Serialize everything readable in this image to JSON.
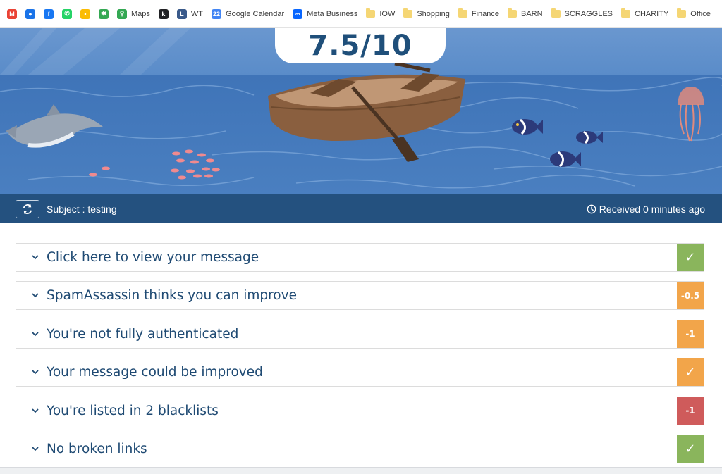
{
  "bookmarks": [
    {
      "label": "",
      "icon": "gmail-icon",
      "color": "#ea4335",
      "glyph": "M"
    },
    {
      "label": "",
      "icon": "contacts-icon",
      "color": "#1a73e8",
      "glyph": "●"
    },
    {
      "label": "",
      "icon": "facebook-icon",
      "color": "#1877f2",
      "glyph": "f"
    },
    {
      "label": "",
      "icon": "whatsapp-icon",
      "color": "#25d366",
      "glyph": "✆"
    },
    {
      "label": "",
      "icon": "keep-icon",
      "color": "#fbbc04",
      "glyph": "▪"
    },
    {
      "label": "",
      "icon": "photos-icon",
      "color": "#34a853",
      "glyph": "✱"
    },
    {
      "label": "Maps",
      "icon": "maps-icon",
      "color": "#34a853",
      "glyph": "⚲"
    },
    {
      "label": "",
      "icon": "app-icon",
      "color": "#202124",
      "glyph": "k"
    },
    {
      "label": "WT",
      "icon": "wt-icon",
      "color": "#3a5a8a",
      "glyph": "L"
    },
    {
      "label": "Google Calendar",
      "icon": "calendar-icon",
      "color": "#4285f4",
      "glyph": "22"
    },
    {
      "label": "Meta Business",
      "icon": "meta-icon",
      "color": "#0866ff",
      "glyph": "∞"
    },
    {
      "label": "IOW",
      "icon": "folder-icon",
      "color": "#f5d674",
      "glyph": ""
    },
    {
      "label": "Shopping",
      "icon": "folder-icon",
      "color": "#f5d674",
      "glyph": ""
    },
    {
      "label": "Finance",
      "icon": "folder-icon",
      "color": "#f5d674",
      "glyph": ""
    },
    {
      "label": "BARN",
      "icon": "folder-icon",
      "color": "#f5d674",
      "glyph": ""
    },
    {
      "label": "SCRAGGLES",
      "icon": "folder-icon",
      "color": "#f5d674",
      "glyph": ""
    },
    {
      "label": "CHARITY",
      "icon": "folder-icon",
      "color": "#f5d674",
      "glyph": ""
    },
    {
      "label": "Office",
      "icon": "folder-icon",
      "color": "#f5d674",
      "glyph": ""
    }
  ],
  "score": "7.5/10",
  "subject": {
    "text": "Subject : testing"
  },
  "received": {
    "text": "Received 0 minutes ago"
  },
  "results": [
    {
      "label": "Click here to view your message",
      "badge": "✓",
      "color": "#8ab55c",
      "kind": "check"
    },
    {
      "label": "SpamAssassin thinks you can improve",
      "badge": "-0.5",
      "color": "#f2a54a",
      "kind": "score"
    },
    {
      "label": "You're not fully authenticated",
      "badge": "-1",
      "color": "#f2a54a",
      "kind": "score"
    },
    {
      "label": "Your message could be improved",
      "badge": "✓",
      "color": "#f2a54a",
      "kind": "check"
    },
    {
      "label": "You're listed in 2 blacklists",
      "badge": "-1",
      "color": "#cf5b5b",
      "kind": "score"
    },
    {
      "label": "No broken links",
      "badge": "✓",
      "color": "#8ab55c",
      "kind": "check"
    }
  ]
}
